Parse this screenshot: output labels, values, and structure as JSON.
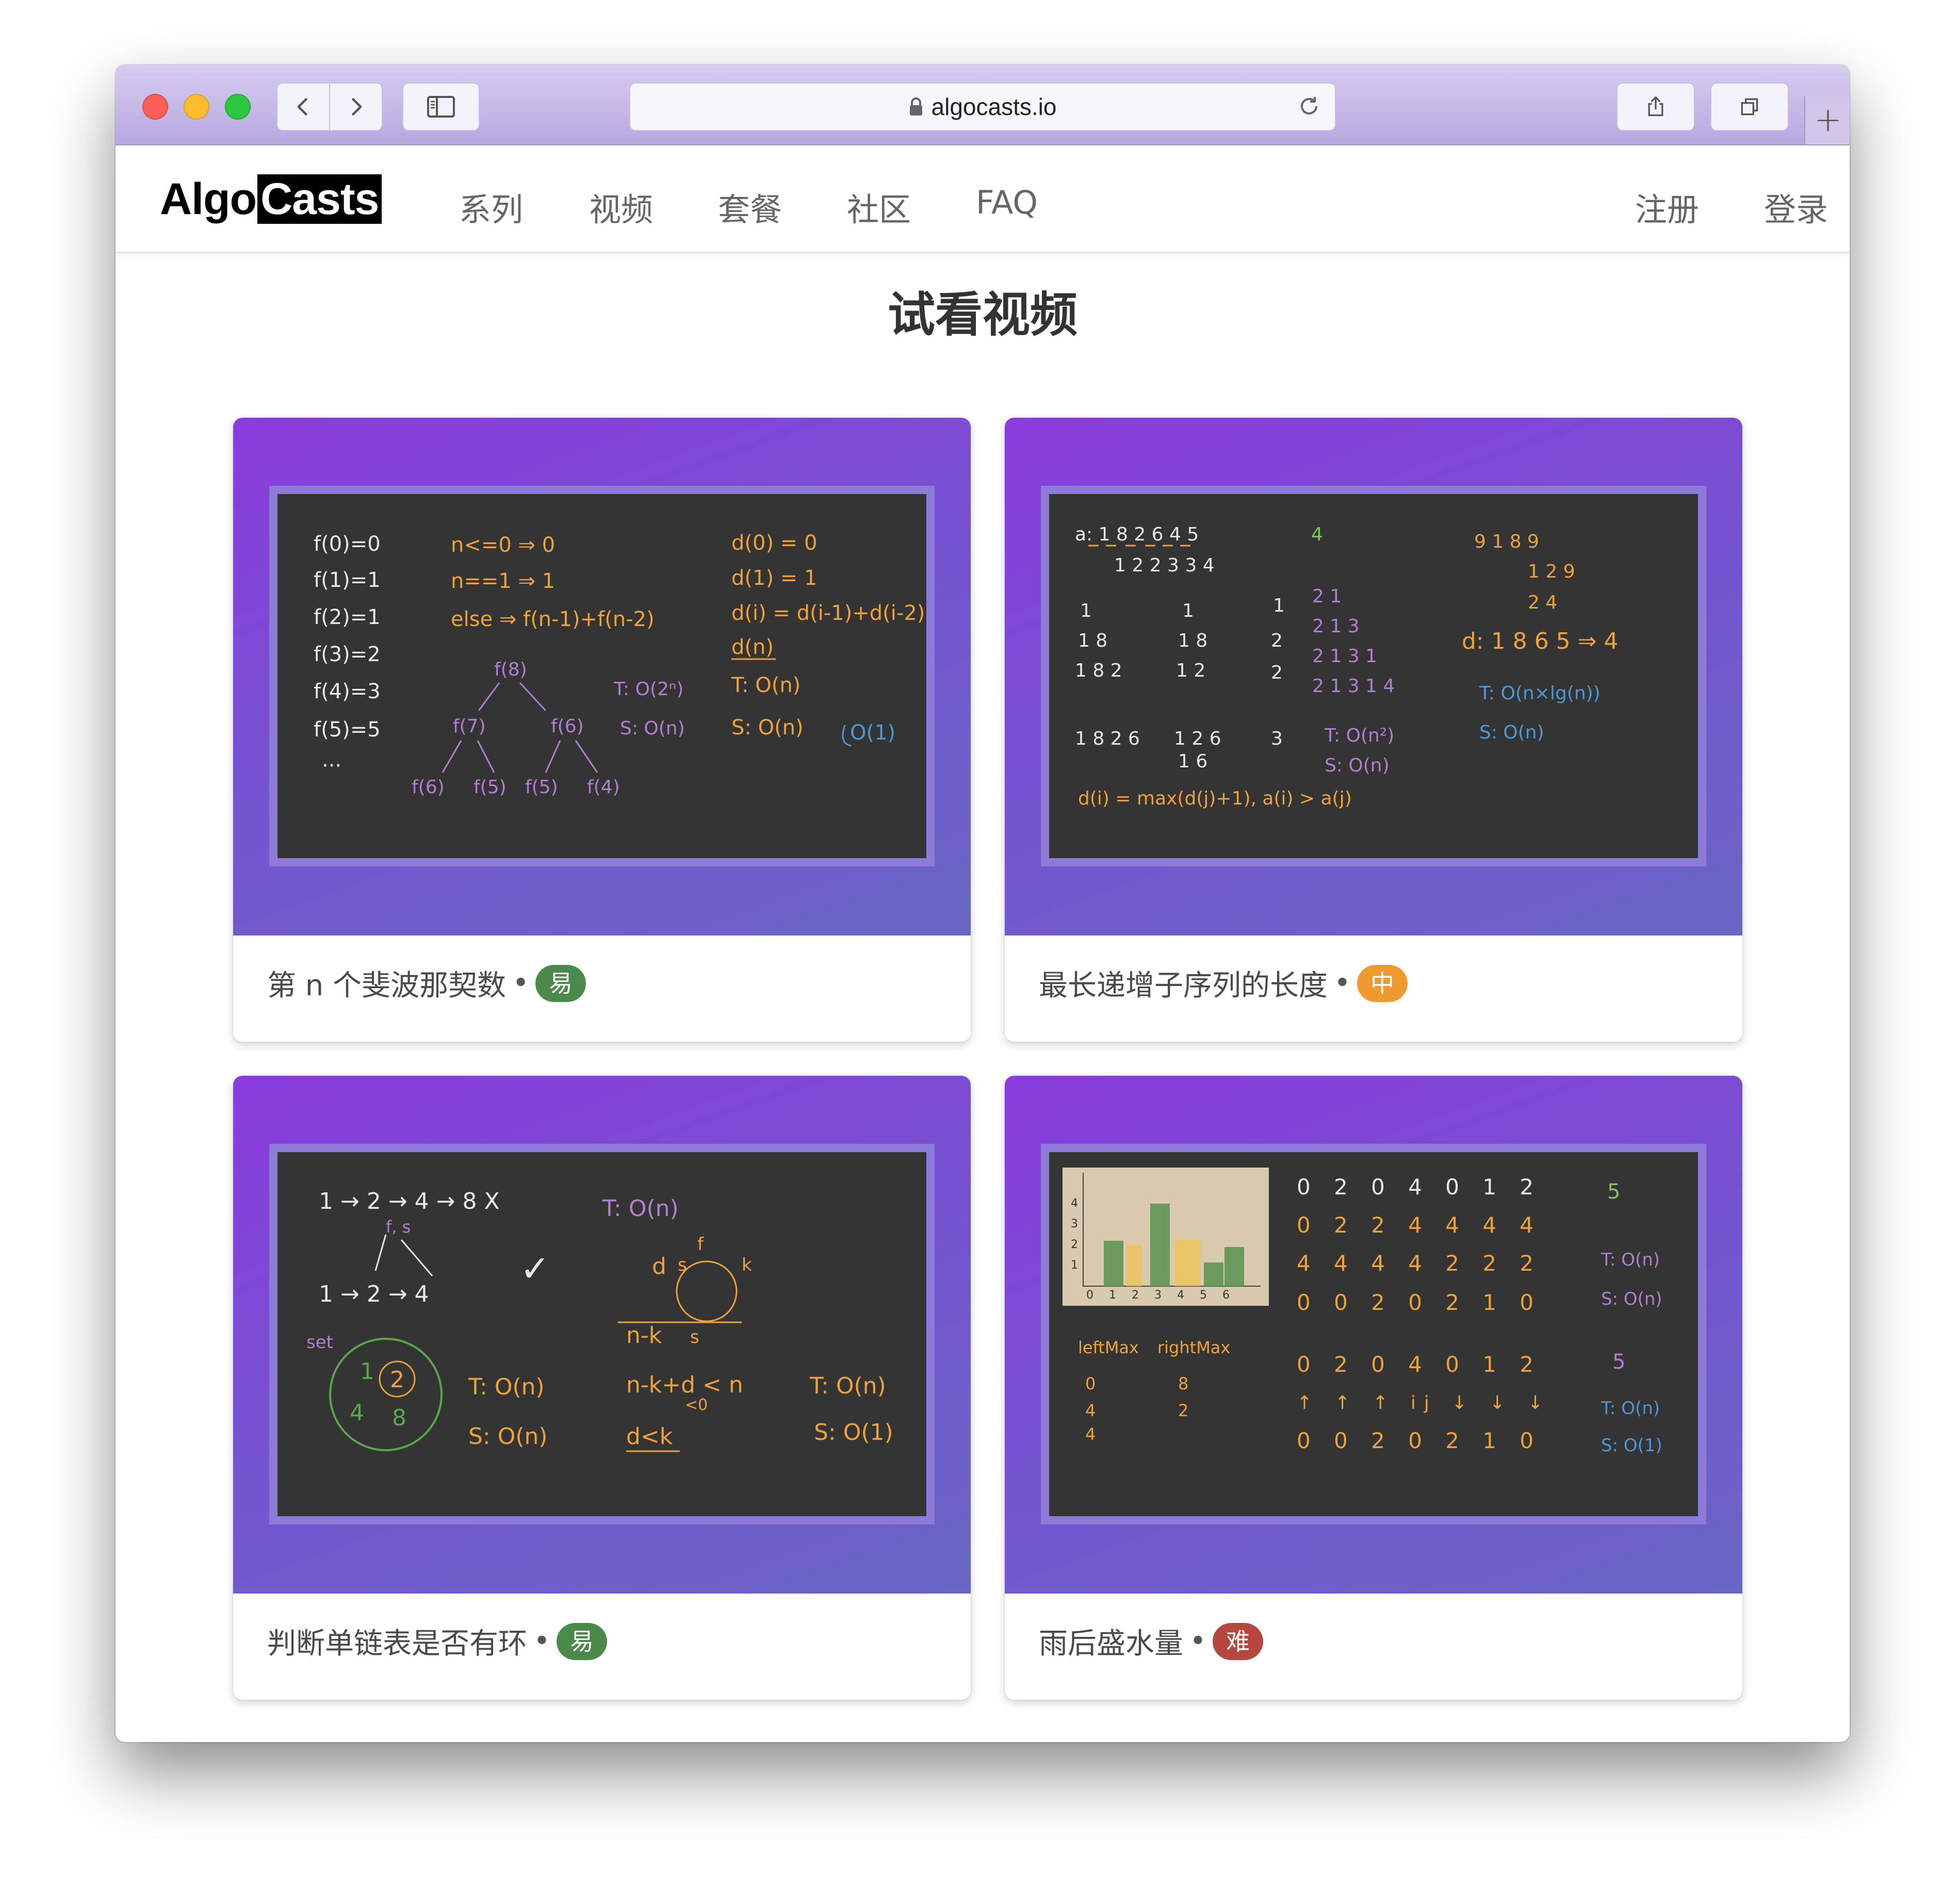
{
  "browser": {
    "url": "algocasts.io",
    "icons": [
      "back-icon",
      "forward-icon",
      "sidebar-icon",
      "lock-icon",
      "reload-icon",
      "share-icon",
      "tabs-icon",
      "new-tab-icon"
    ]
  },
  "nav": {
    "logo_part1": "Algo",
    "logo_part2": "Casts",
    "items": [
      "系列",
      "视频",
      "套餐",
      "社区",
      "FAQ"
    ],
    "register": "注册",
    "login": "登录"
  },
  "page": {
    "title": "试看视频"
  },
  "cards": [
    {
      "title": "第 n 个斐波那契数",
      "difficulty": "易",
      "difficulty_color": "#4c8a4c"
    },
    {
      "title": "最长递增子序列的长度",
      "difficulty": "中",
      "difficulty_color": "#ef9a2f"
    },
    {
      "title": "判断单链表是否有环",
      "difficulty": "易",
      "difficulty_color": "#4c8a4c"
    },
    {
      "title": "雨后盛水量",
      "difficulty": "难",
      "difficulty_color": "#b5473f"
    }
  ],
  "boards": {
    "fib": {
      "white": [
        "f(0)=0",
        "f(1)=1",
        "f(2)=1",
        "f(3)=2",
        "f(4)=3",
        "f(5)=5",
        "···"
      ],
      "orange_mid": [
        "n<=0   ⇒ 0",
        "n==1   ⇒ 1",
        "else   ⇒ f(n-1)+f(n-2)"
      ],
      "purple_tree": [
        "f(8)",
        "f(7)",
        "f(6)",
        "f(6)",
        "f(5)",
        "f(5)",
        "f(4)"
      ],
      "purple_complexity": [
        "T: O(2ⁿ)",
        "S: O(n)"
      ],
      "orange_right": [
        "d(0) = 0",
        "d(1) = 1",
        "d(i) = d(i-1)+d(i-2)",
        "d(n)",
        "T: O(n)",
        "S: O(n)"
      ],
      "blue": "O(1)"
    },
    "lis": {
      "white_rows": [
        "a: 1 8 2 6 4 5",
        "1 2 2 3 3 4"
      ],
      "green": "4",
      "orange": [
        "9    1 8 9",
        "1 2 9",
        "2 4",
        "d: 1 8 6 5 ⇒ 4",
        "d(i) = max(d(j)+1), a(i) > a(j)"
      ],
      "white_cols": [
        "1",
        "1 8",
        "1 8 2",
        "1 8 2 6",
        "1",
        "1 8",
        "1 2",
        "1 2 6",
        "1 6",
        "1",
        "2",
        "2",
        "3"
      ],
      "purple": [
        "2 1",
        "2 1 3",
        "2 1 3 1",
        "2 1 3 1 4",
        "T: O(n²)",
        "S: O(n)"
      ],
      "blue": [
        "T: O(n×lg(n))",
        "S: O(n)"
      ]
    },
    "cycle": {
      "white": [
        "1 → 2 → 4 → 8   X",
        "1 → 2 → 4",
        "✓",
        "T: O(n)",
        "S: O(n)"
      ],
      "purple": [
        "T: O(n)",
        "f, s",
        "set"
      ],
      "green": [
        "1",
        "2",
        "4",
        "8"
      ],
      "orange": [
        "d",
        "s",
        "f",
        "k",
        "n-k",
        "s",
        "n-k+d  < n",
        "<0",
        "d<k",
        "T: O(n)",
        "S: O(1)"
      ]
    },
    "rain": {
      "orange_rows": [
        "0 2 0 4 0 1 2",
        "0 2 2 4 4 4 4",
        "4 4 4 4 2 2 2",
        "0 0 2 0 2 1 0"
      ],
      "orange_bottom": [
        "leftMax",
        "rightMax",
        "0 2 0 4 0 1 2",
        "↑ ↑ ↑ ij ↓ ↓ ↓",
        "0 0 2 0 2 1 0"
      ],
      "green": "5",
      "purple": [
        "T: O(n)",
        "S: O(n)",
        "5"
      ],
      "blue": [
        "T: O(n)",
        "S: O(1)"
      ],
      "axis_x": [
        "0",
        "1",
        "2",
        "3",
        "4",
        "5",
        "6"
      ],
      "axis_y": [
        "1",
        "2",
        "3",
        "4"
      ],
      "left_cols": [
        "0",
        "2",
        "4",
        "8",
        "4"
      ]
    }
  }
}
